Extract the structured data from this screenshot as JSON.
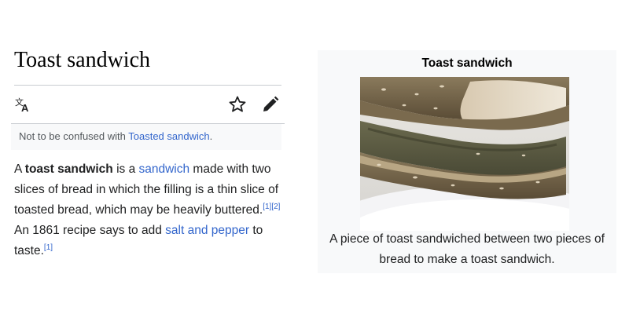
{
  "article": {
    "title": "Toast sandwich",
    "toolbar": {
      "language_icon": "language-translate-icon",
      "watch_icon": "star-icon",
      "edit_icon": "pencil-icon"
    },
    "hatnote": {
      "prefix": "Not to be confused with ",
      "link": "Toasted sandwich",
      "suffix": "."
    },
    "body": {
      "t1": "A ",
      "bold_term": "toast sandwich",
      "t2": " is a ",
      "link_sandwich": "sandwich",
      "t3": " made with two slices of bread in which the filling is a thin slice of toasted bread, which may be heavily buttered.",
      "ref1": "[1]",
      "ref2": "[2]",
      "t4": " An 1861 recipe says to add ",
      "link_salt_pepper": "salt and pepper",
      "t5": " to taste.",
      "ref3": "[1]"
    }
  },
  "infobox": {
    "title": "Toast sandwich",
    "image_subject": "toast-sandwich-photo",
    "caption": "A piece of toast sandwiched between two pieces of bread to make a toast sandwich."
  },
  "colors": {
    "link": "#3366cc",
    "text": "#202122",
    "hatnote_bg": "#f8f9fa",
    "infobox_bg": "#f8f9fa",
    "rule": "#c8ccd1"
  }
}
